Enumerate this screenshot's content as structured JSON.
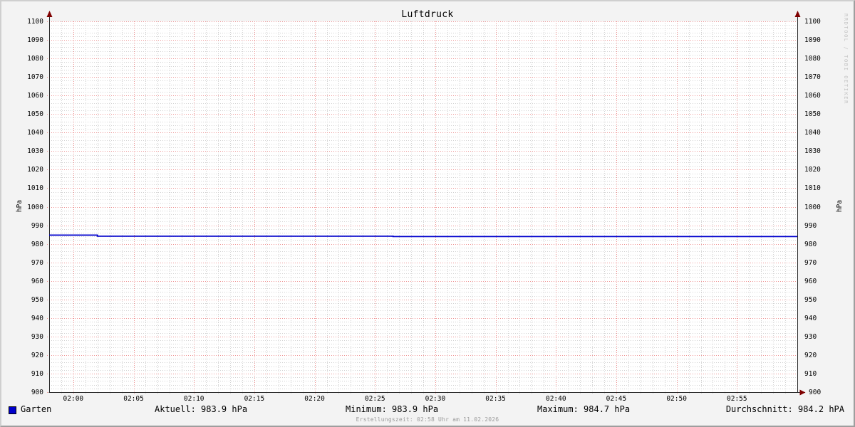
{
  "title": "Luftdruck",
  "watermark": "RRDTOOL / TOBI OETIKER",
  "legend": {
    "label": "Garten",
    "color": "#0000cc"
  },
  "stats": {
    "aktuell": "Aktuell: 983.9 hPa",
    "minimum": "Minimum: 983.9 hPa",
    "maximum": "Maximum: 984.7 hPa",
    "durchschnitt": "Durchschnitt: 984.2 hPA"
  },
  "footer": {
    "creation": "Erstellungszeit: 02:58 Uhr am 11.02.2026"
  },
  "colors": {
    "background": "#f3f3f3",
    "canvas": "#ffffff",
    "grid_major": "#ee9393",
    "grid_minor": "#d2d2d2",
    "axis": "#2b2b2b",
    "arrow": "#7f0000",
    "series": "#0000cc",
    "text_muted": "#9a9a9a"
  },
  "chart_data": {
    "type": "line",
    "title": "Luftdruck",
    "ylabel_left": "hPa",
    "ylabel_right": "hPa",
    "ylim": [
      900,
      1100
    ],
    "y_ticks": [
      900,
      910,
      920,
      930,
      940,
      950,
      960,
      970,
      980,
      990,
      1000,
      1010,
      1020,
      1030,
      1040,
      1050,
      1060,
      1070,
      1080,
      1090,
      1100
    ],
    "y_major_step": 10,
    "y_minor_step": 2,
    "x_ticks": [
      "02:00",
      "02:05",
      "02:10",
      "02:15",
      "02:20",
      "02:25",
      "02:30",
      "02:35",
      "02:40",
      "02:45",
      "02:50",
      "02:55"
    ],
    "x_major_step_min": 5,
    "x_minor_step_min": 1,
    "x_range_minutes": [
      -2,
      60
    ],
    "grid": true,
    "legend_position": "bottom",
    "series": [
      {
        "name": "Garten",
        "color": "#0000cc",
        "points": [
          {
            "m": -2,
            "v": 984.7
          },
          {
            "m": 2,
            "v": 984.7
          },
          {
            "m": 2,
            "v": 984.1
          },
          {
            "m": 26.5,
            "v": 984.1
          },
          {
            "m": 26.5,
            "v": 983.9
          },
          {
            "m": 60,
            "v": 983.9
          }
        ]
      }
    ],
    "stats": {
      "aktuell": 983.9,
      "minimum": 983.9,
      "maximum": 984.7,
      "durchschnitt": 984.2
    }
  }
}
